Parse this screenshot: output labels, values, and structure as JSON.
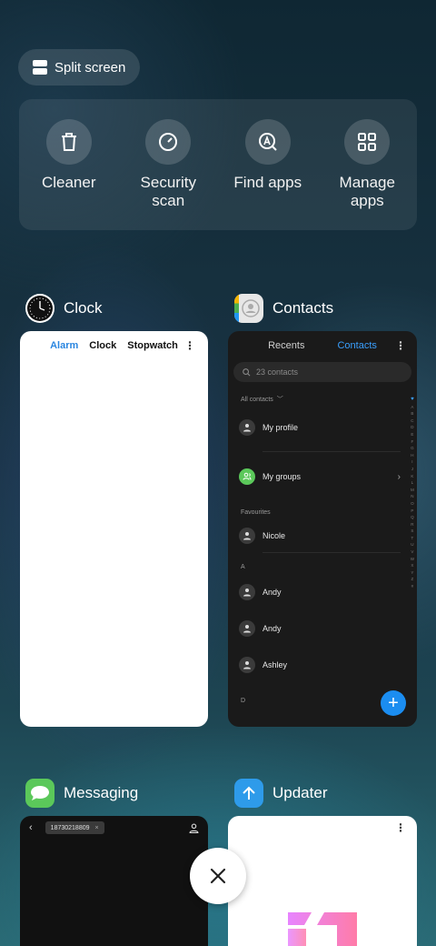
{
  "split_screen": {
    "label": "Split screen"
  },
  "shortcuts": [
    {
      "label": "Cleaner",
      "icon": "trash-icon"
    },
    {
      "label": "Security\nscan",
      "icon": "gauge-icon"
    },
    {
      "label": "Find apps",
      "icon": "search-a-icon"
    },
    {
      "label": "Manage\napps",
      "icon": "grid-icon"
    }
  ],
  "apps": {
    "clock": {
      "name": "Clock",
      "tabs": [
        "Alarm",
        "Clock",
        "Stopwatch"
      ],
      "active_tab": "Alarm"
    },
    "contacts": {
      "name": "Contacts",
      "tabs": [
        "Recents",
        "Contacts"
      ],
      "active_tab": "Contacts",
      "search_placeholder": "23 contacts",
      "filter_label": "All contacts",
      "my_profile": "My profile",
      "my_groups": "My groups",
      "favourites_header": "Favourites",
      "favourite_contact": "Nicole",
      "section_a": "A",
      "section_d": "D",
      "contacts_a": [
        "Andy",
        "Andy",
        "Ashley"
      ],
      "alphabet": [
        "A",
        "B",
        "C",
        "D",
        "E",
        "F",
        "G",
        "H",
        "I",
        "J",
        "K",
        "L",
        "M",
        "N",
        "O",
        "P",
        "Q",
        "R",
        "S",
        "T",
        "U",
        "V",
        "W",
        "X",
        "Y",
        "Z",
        "#"
      ],
      "accent": "#1b8df0"
    },
    "messaging": {
      "name": "Messaging",
      "recipient": "18730218809",
      "accent": "#5bc85a"
    },
    "updater": {
      "name": "Updater",
      "accent": "#2e9bea"
    }
  },
  "close_button": {
    "icon": "close-icon"
  }
}
